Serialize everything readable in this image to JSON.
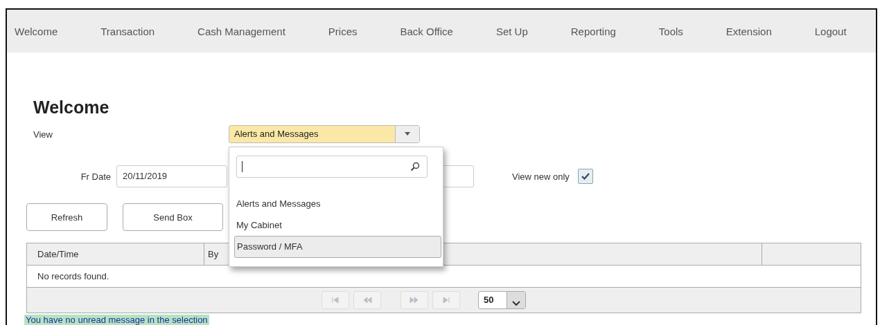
{
  "nav": {
    "items": [
      "Welcome",
      "Transaction",
      "Cash Management",
      "Prices",
      "Back Office",
      "Set Up",
      "Reporting",
      "Tools",
      "Extension",
      "Logout"
    ]
  },
  "page_title": "Welcome",
  "view": {
    "label": "View",
    "value": "Alerts and Messages",
    "open": true,
    "options": [
      {
        "label": "Alerts and Messages",
        "highlighted": false
      },
      {
        "label": "My Cabinet",
        "highlighted": false
      },
      {
        "label": "Password / MFA",
        "highlighted": true
      }
    ]
  },
  "from_date": {
    "label": "Fr Date",
    "value": "20/11/2019"
  },
  "view_new_only": {
    "label": "View new only",
    "checked": true
  },
  "buttons": [
    "Refresh",
    "Send Box"
  ],
  "table": {
    "columns": [
      "Date/Time",
      "By"
    ],
    "empty_message": "No records found."
  },
  "pager": {
    "buttons": [
      {
        "kind": "first",
        "disabled": true
      },
      {
        "kind": "prev",
        "disabled": true
      },
      {
        "kind": "next",
        "disabled": true
      },
      {
        "kind": "last",
        "disabled": true
      }
    ],
    "page_size": "50"
  },
  "status_message": "You have no unread message in the selection"
}
